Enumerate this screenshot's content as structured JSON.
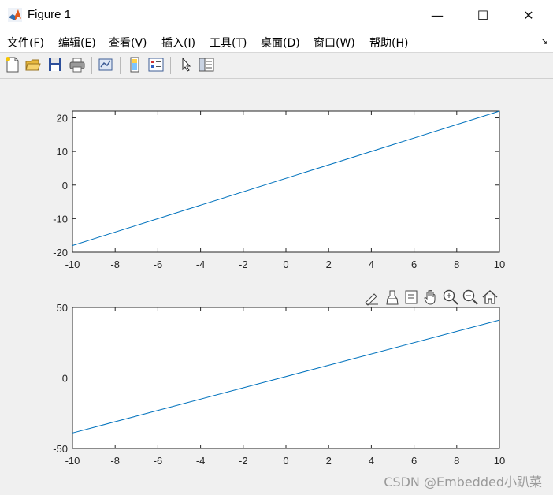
{
  "window": {
    "title": "Figure 1",
    "minimize": "—",
    "maximize": "☐",
    "close": "✕"
  },
  "menu": {
    "items": [
      "文件(F)",
      "编辑(E)",
      "查看(V)",
      "插入(I)",
      "工具(T)",
      "桌面(D)",
      "窗口(W)",
      "帮助(H)"
    ],
    "dock_glyph": "↘"
  },
  "toolbar": {
    "icons": [
      "new-figure-icon",
      "open-file-icon",
      "save-icon",
      "print-icon",
      "link-plot-icon",
      "insert-colorbar-icon",
      "insert-legend-icon",
      "pointer-icon",
      "property-inspector-icon"
    ]
  },
  "axes_toolbar": {
    "icons": [
      "edit-brush-icon",
      "data-brush-icon",
      "data-tips-icon",
      "pan-icon",
      "zoom-in-icon",
      "zoom-out-icon",
      "home-icon"
    ]
  },
  "colors": {
    "line": "#0072bd",
    "axes_bg": "#ffffff",
    "figure_bg": "#f0f0f0"
  },
  "chart_data": [
    {
      "type": "line",
      "title": "",
      "xlabel": "",
      "ylabel": "",
      "xlim": [
        -10,
        10
      ],
      "ylim": [
        -20,
        22
      ],
      "xticks": [
        -10,
        -8,
        -6,
        -4,
        -2,
        0,
        2,
        4,
        6,
        8,
        10
      ],
      "yticks": [
        -20,
        -10,
        0,
        10,
        20
      ],
      "grid": false,
      "series": [
        {
          "x": [
            -10,
            10
          ],
          "y": [
            -18,
            22
          ]
        }
      ]
    },
    {
      "type": "line",
      "title": "",
      "xlabel": "",
      "ylabel": "",
      "xlim": [
        -10,
        10
      ],
      "ylim": [
        -50,
        50
      ],
      "xticks": [
        -10,
        -8,
        -6,
        -4,
        -2,
        0,
        2,
        4,
        6,
        8,
        10
      ],
      "yticks": [
        -50,
        0,
        50
      ],
      "grid": false,
      "series": [
        {
          "x": [
            -10,
            10
          ],
          "y": [
            -39,
            41
          ]
        }
      ]
    }
  ],
  "watermark": "CSDN @Embedded小趴菜"
}
